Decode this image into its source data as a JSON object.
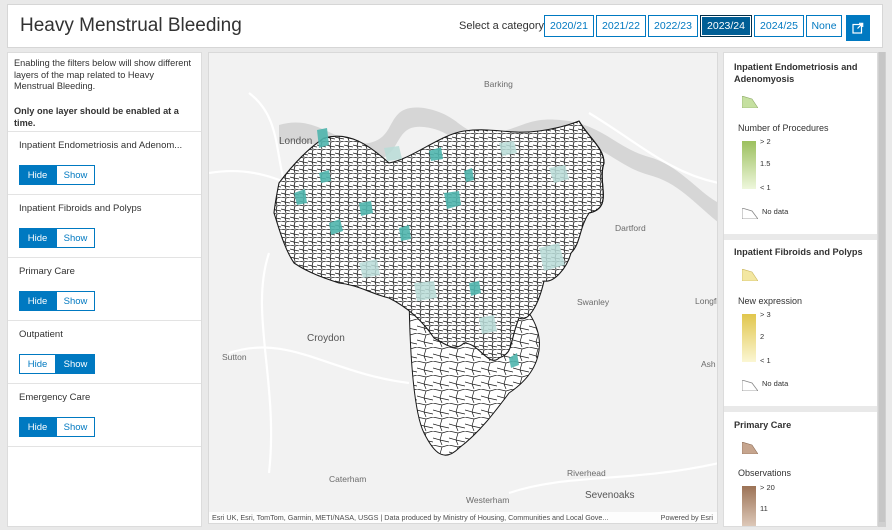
{
  "header": {
    "title": "Heavy Menstrual Bleeding",
    "category_label": "Select a category",
    "categories": [
      "2020/21",
      "2021/22",
      "2022/23",
      "2023/24",
      "2024/25",
      "None"
    ],
    "active_category": "2023/24",
    "external_icon": "external-link-icon"
  },
  "left_panel": {
    "intro": "Enabling the filters below will show different layers of the map related to Heavy Menstrual Bleeding.",
    "intro_bold": "Only one layer should be enabled at a time.",
    "filters": [
      {
        "title": "Inpatient Endometriosis and Adenom...",
        "hide": "Hide",
        "show": "Show",
        "state": "hide"
      },
      {
        "title": "Inpatient Fibroids and Polyps",
        "hide": "Hide",
        "show": "Show",
        "state": "hide"
      },
      {
        "title": "Primary Care",
        "hide": "Hide",
        "show": "Show",
        "state": "hide"
      },
      {
        "title": "Outpatient",
        "hide": "Hide",
        "show": "Show",
        "state": "show"
      },
      {
        "title": "Emergency Care",
        "hide": "Hide",
        "show": "Show",
        "state": "hide"
      }
    ]
  },
  "map": {
    "labels": {
      "barking": "Barking",
      "london": "London",
      "dartford": "Dartford",
      "swanley": "Swanley",
      "longfield": "Longfie",
      "croydon": "Croydon",
      "sutton": "Sutton",
      "ash": "Ash",
      "caterham": "Caterham",
      "riverhead": "Riverhead",
      "sevenoaks": "Sevenoaks",
      "westerham": "Westerham"
    },
    "attribution": "Esri UK, Esri, TomTom, Garmin, METI/NASA, USGS | Data produced by Ministry of Housing, Communities and Local Gove...",
    "powered_by": "Powered by Esri"
  },
  "legend": {
    "sections": [
      {
        "title": "Inpatient Endometriosis and Adenomyosis",
        "swatch_color": "#c5e0a0",
        "subtitle": "Number of Procedures",
        "ticks": [
          "> 2",
          "1.5",
          "< 1"
        ],
        "grad_top": "#9cc05e",
        "grad_bottom": "#eef7dc",
        "nodata": "No data"
      },
      {
        "title": "Inpatient Fibroids and Polyps",
        "swatch_color": "#f3e7a1",
        "subtitle": "New expression",
        "ticks": [
          "> 3",
          "2",
          "< 1"
        ],
        "grad_top": "#e1c64d",
        "grad_bottom": "#fbf6d3",
        "nodata": "No data"
      },
      {
        "title": "Primary Care",
        "swatch_color": "#c6a58e",
        "subtitle": "Observations",
        "ticks": [
          "> 20",
          "11"
        ],
        "grad_top": "#9c7356",
        "grad_bottom": "#ead9cc"
      }
    ]
  },
  "colors": {
    "accent": "#0079c1",
    "active_category": "#005e95",
    "map_teal": "#4fb5ad",
    "map_teal_light": "#b9dcd8",
    "map_background": "#f2f2f2",
    "river": "#d9d9d9"
  }
}
